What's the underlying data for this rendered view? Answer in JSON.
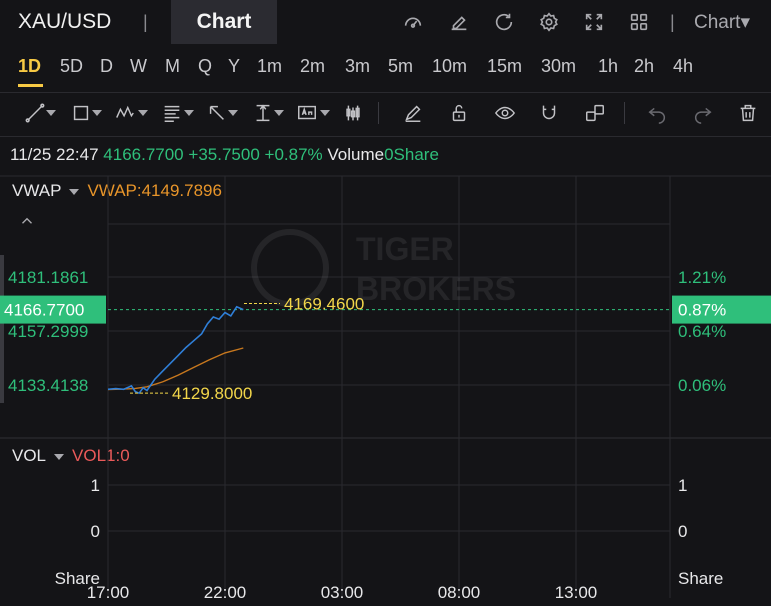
{
  "header": {
    "symbol": "XAU/USD",
    "separator": "|",
    "active_tab": "Chart",
    "chart_menu": "Chart▾"
  },
  "intervals": [
    "1D",
    "5D",
    "D",
    "W",
    "M",
    "Q",
    "Y",
    "1m",
    "2m",
    "3m",
    "5m",
    "10m",
    "15m",
    "30m",
    "1h",
    "2h",
    "4h"
  ],
  "active_interval": "1D",
  "quote": {
    "datetime": "11/25 22:47",
    "price": "4166.7700",
    "change": "+35.7500",
    "change_pct": "+0.87%",
    "volume_label": "Volume",
    "volume_value": "0Share"
  },
  "indicators": {
    "main_name": "VWAP",
    "main_value": "VWAP:4149.7896",
    "vol_name": "VOL",
    "vol_value": "VOL1:0"
  },
  "watermark": {
    "line1": "TIGER",
    "line2": "BROKERS"
  },
  "colors": {
    "up": "#2fbf7b",
    "price_line": "#2f7fd8",
    "vwap_line": "#c8781e",
    "highlight": "#f2d64a",
    "badge": "#2fbf7b"
  },
  "chart_data": [
    {
      "type": "line",
      "x_ticks": [
        "17:00",
        "22:00",
        "03:00",
        "08:00",
        "13:00"
      ],
      "y_ticks_left": [
        "4181.1861",
        "4157.2999",
        "4133.4138"
      ],
      "y_ticks_right": [
        "1.21%",
        "0.64%",
        "0.06%"
      ],
      "current_price_label": "4166.7700",
      "current_pct_label": "0.87%",
      "high_label": "4169.4600",
      "low_label": "4129.8000",
      "ylim": [
        4118,
        4200
      ],
      "series": [
        {
          "name": "",
          "x": [
            "17:00",
            "17:20",
            "17:40",
            "18:00",
            "18:10",
            "18:20",
            "18:30",
            "18:40",
            "19:00",
            "19:20",
            "19:40",
            "20:00",
            "20:20",
            "20:40",
            "21:00",
            "21:15",
            "21:30",
            "21:45",
            "22:00",
            "22:15",
            "22:30",
            "22:47"
          ],
          "values": [
            4131.5,
            4131.8,
            4131.5,
            4133.0,
            4130.5,
            4129.8,
            4132.2,
            4131.0,
            4136.0,
            4139.5,
            4143.0,
            4146.5,
            4150.0,
            4153.0,
            4156.0,
            4160.5,
            4163.5,
            4162.5,
            4165.5,
            4164.0,
            4168.0,
            4166.77
          ]
        },
        {
          "name": "VWAP",
          "x": [
            "17:00",
            "17:40",
            "18:10",
            "18:40",
            "19:20",
            "20:00",
            "20:40",
            "21:20",
            "22:00",
            "22:47"
          ],
          "values": [
            4131.4,
            4131.6,
            4131.9,
            4132.6,
            4134.8,
            4137.8,
            4141.2,
            4144.6,
            4147.6,
            4149.79
          ]
        }
      ]
    },
    {
      "type": "bar",
      "y_ticks_left": [
        "1",
        "0"
      ],
      "y_ticks_right": [
        "1",
        "0"
      ],
      "unit_label": "Share",
      "ylim": [
        0,
        1
      ],
      "values": []
    }
  ]
}
